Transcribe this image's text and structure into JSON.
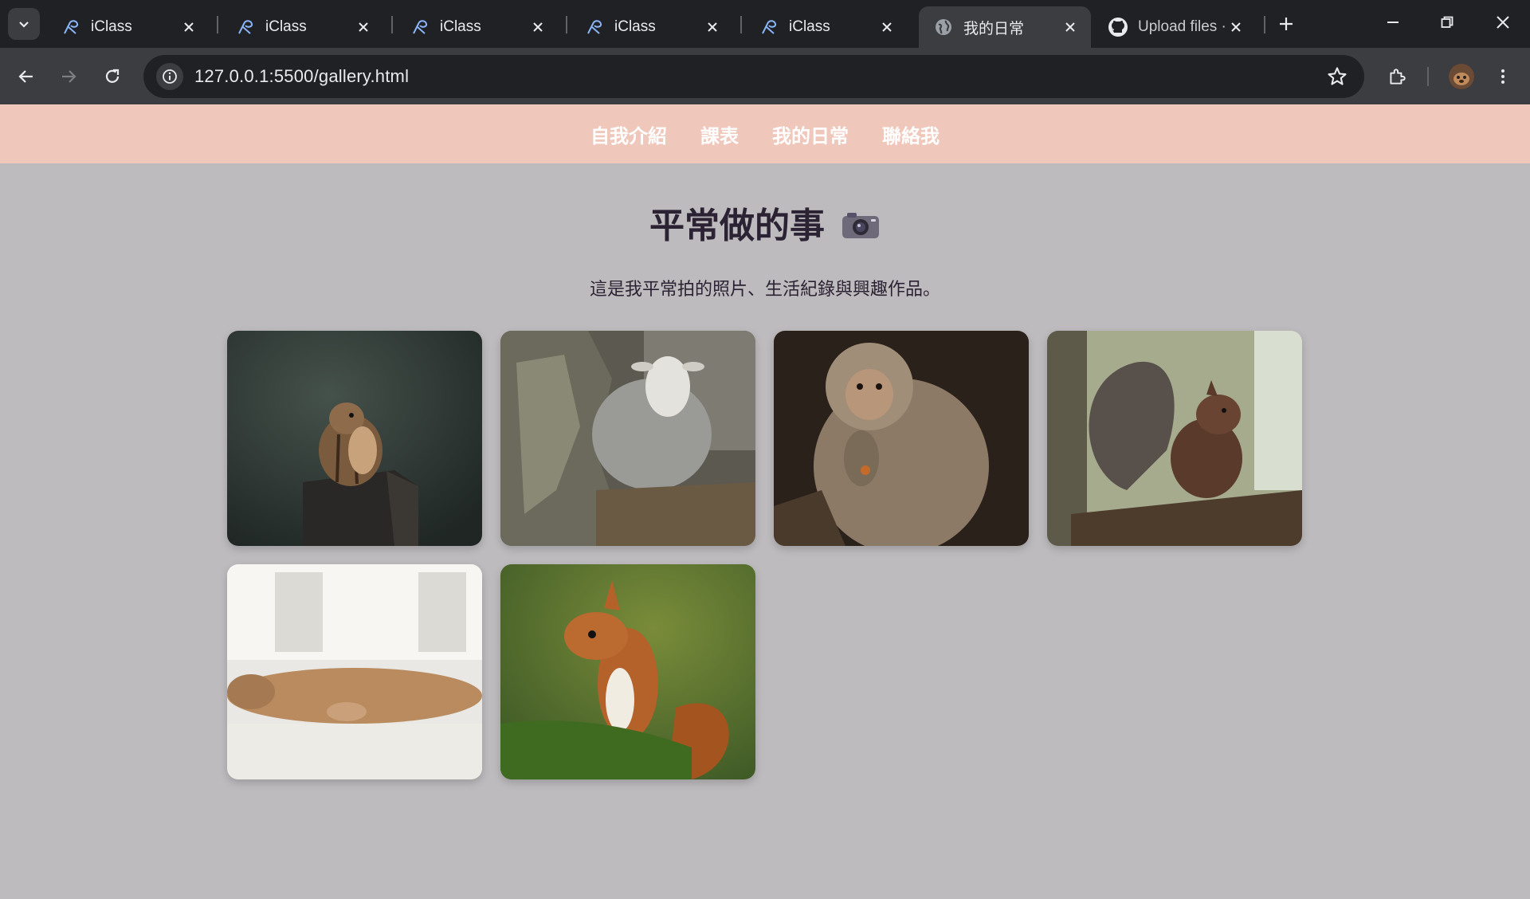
{
  "browser": {
    "tabs": [
      {
        "title": "iClass",
        "icon": "iclass-icon"
      },
      {
        "title": "iClass",
        "icon": "iclass-icon"
      },
      {
        "title": "iClass",
        "icon": "iclass-icon"
      },
      {
        "title": "iClass",
        "icon": "iclass-icon"
      },
      {
        "title": "iClass",
        "icon": "iclass-icon"
      },
      {
        "title": "我的日常",
        "icon": "globe-icon",
        "active": true
      },
      {
        "title": "Upload files ·",
        "icon": "github-icon"
      }
    ],
    "url": "127.0.0.1:5500/gallery.html"
  },
  "nav": {
    "items": [
      "自我介紹",
      "課表",
      "我的日常",
      "聯絡我"
    ]
  },
  "page": {
    "title": "平常做的事",
    "title_icon": "camera-icon",
    "subtitle": "這是我平常拍的照片、生活紀錄與興趣作品。"
  },
  "gallery": {
    "photos": [
      {
        "name": "chipmunk-photo",
        "subject": "chipmunk on a wooden post"
      },
      {
        "name": "sheep-photo",
        "subject": "sheep behind a mossy rock"
      },
      {
        "name": "monkey-photo",
        "subject": "macaque eating"
      },
      {
        "name": "squirrel-photo-1",
        "subject": "squirrel on a log"
      },
      {
        "name": "cat-photo",
        "subject": "cat sleeping on a bed"
      },
      {
        "name": "squirrel-photo-2",
        "subject": "red squirrel on moss"
      }
    ]
  },
  "colors": {
    "nav_bg": "#efc8bb",
    "page_bg": "#bdbbbd",
    "text": "#2b2233",
    "chrome_dark": "#202124",
    "chrome_mid": "#3c3d40"
  }
}
